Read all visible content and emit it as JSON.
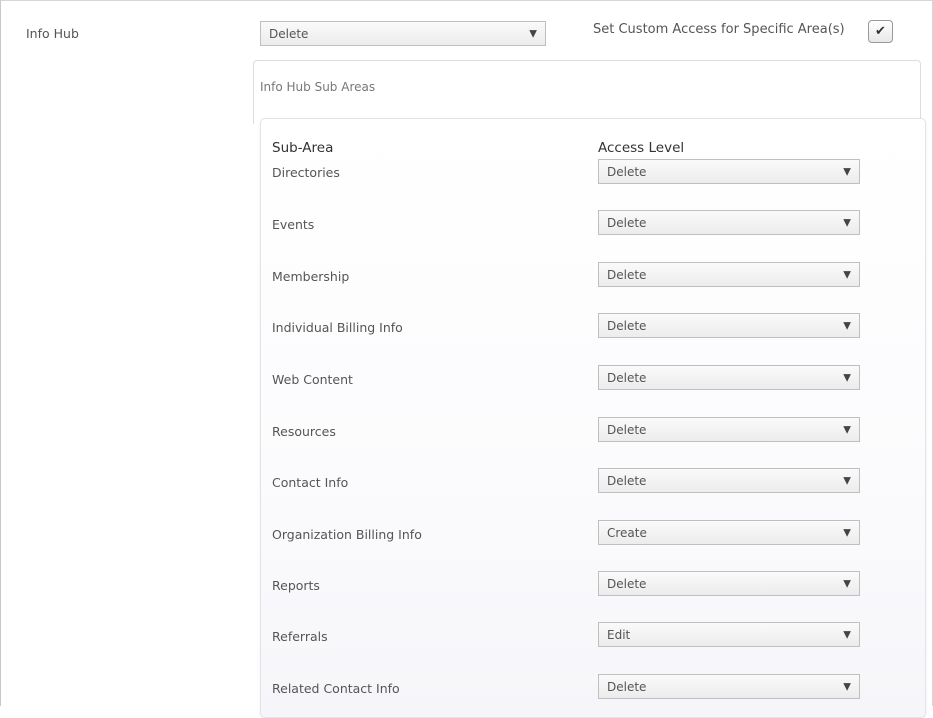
{
  "section": {
    "label": "Info Hub",
    "access_select": {
      "value": "Delete",
      "caret": "▼"
    },
    "custom_access": {
      "label": "Set Custom Access for Specific Area(s)",
      "checked": true,
      "check_glyph": "✔"
    }
  },
  "subareas": {
    "title": "Info Hub Sub Areas",
    "columns": {
      "subarea": "Sub-Area",
      "access": "Access Level"
    },
    "rows": [
      {
        "name": "Directories",
        "access": "Delete"
      },
      {
        "name": "Events",
        "access": "Delete"
      },
      {
        "name": "Membership",
        "access": "Delete"
      },
      {
        "name": "Individual Billing Info",
        "access": "Delete"
      },
      {
        "name": "Web Content",
        "access": "Delete"
      },
      {
        "name": "Resources",
        "access": "Delete"
      },
      {
        "name": "Contact Info",
        "access": "Delete"
      },
      {
        "name": "Organization Billing Info",
        "access": "Create"
      },
      {
        "name": "Reports",
        "access": "Delete"
      },
      {
        "name": "Referrals",
        "access": "Edit"
      },
      {
        "name": "Related Contact Info",
        "access": "Delete"
      }
    ]
  }
}
